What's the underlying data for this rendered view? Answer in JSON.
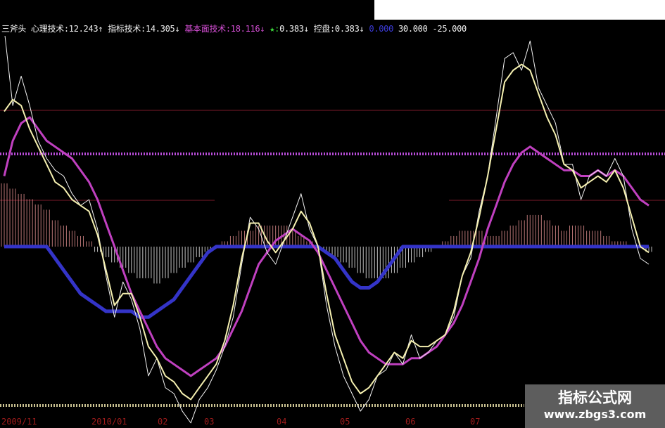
{
  "legend": {
    "name": "三斧头",
    "items": [
      {
        "label": "心理技术: ",
        "value": "12.243↑",
        "color": "#f2f2f2"
      },
      {
        "label": "指标技术: ",
        "value": "14.305↓",
        "color": "#f2f2f2"
      },
      {
        "label": "基本面技术: ",
        "value": "18.116↓",
        "color": "#d64fd6"
      },
      {
        "label": "★: ",
        "value": "0.383↓",
        "color": "#3ddc3d"
      },
      {
        "label": "控盘: ",
        "value": "0.383↓",
        "color": "#f2f2f2"
      }
    ],
    "tail": [
      {
        "text": "0.000",
        "color": "#3b3bd8"
      },
      {
        "text": "30.000",
        "color": "#f2f2f2"
      },
      {
        "text": "-25.000",
        "color": "#f2f2f2"
      }
    ]
  },
  "watermark": {
    "title": "指标公式网",
    "url": "www.zbgs3.com"
  },
  "colors": {
    "background": "#000000",
    "psych_line": "#f2f2f2",
    "indicator_line": "#f5f0b0",
    "fundamental_line": "#c040c0",
    "control_line": "#3434c8",
    "level_line_pink": "#b84cd8",
    "level_line_red": "#7a1a2a",
    "hist_up": "#d98a8a",
    "hist_down": "#e6e6e6",
    "axis_label": "#9e1b1b"
  },
  "chart_data": {
    "type": "line",
    "title": "三斧头",
    "x_labels": [
      "2009/11",
      "2010/01",
      "02",
      "03",
      "04",
      "05",
      "06",
      "07"
    ],
    "ylim": [
      -25,
      30
    ],
    "reference_levels": [
      {
        "name": "line-30",
        "value": 30,
        "style": "dotted-magenta"
      },
      {
        "name": "line-0",
        "value": 0,
        "style": "blue-control-base"
      }
    ],
    "series": [
      {
        "name": "心理技术",
        "values": [
          37,
          24,
          29,
          24,
          18,
          15,
          13,
          12,
          9,
          7,
          8,
          3,
          -5,
          -12,
          -6,
          -9,
          -14,
          -22,
          -19,
          -24,
          -25,
          -28,
          -30,
          -26,
          -24,
          -21,
          -17,
          -12,
          -3,
          5,
          3,
          -1,
          -3,
          1,
          5,
          9,
          3,
          0,
          -10,
          -17,
          -22,
          -25,
          -28,
          -26,
          -22,
          -21,
          -18,
          -20,
          -15,
          -19,
          -18,
          -16,
          -15,
          -12,
          -5,
          -2,
          6,
          12,
          22,
          32,
          33,
          30,
          35,
          27,
          24,
          21,
          14,
          14,
          8,
          12,
          13,
          12,
          15,
          12,
          3,
          -2,
          -3
        ]
      },
      {
        "name": "指标技术",
        "values": [
          23,
          25,
          24,
          20,
          17,
          14,
          11,
          10,
          8,
          7,
          6,
          2,
          -4,
          -10,
          -8,
          -8,
          -12,
          -17,
          -19,
          -22,
          -23,
          -25,
          -26,
          -24,
          -22,
          -20,
          -16,
          -10,
          -2,
          4,
          4,
          1,
          -1,
          1,
          3,
          6,
          4,
          0,
          -8,
          -15,
          -19,
          -23,
          -25,
          -24,
          -22,
          -20,
          -18,
          -19,
          -16,
          -17,
          -17,
          -16,
          -15,
          -11,
          -5,
          -1,
          5,
          12,
          20,
          28,
          30,
          31,
          30,
          26,
          22,
          19,
          14,
          13,
          10,
          11,
          12,
          11,
          13,
          10,
          5,
          0,
          -1
        ]
      },
      {
        "name": "基本面技术",
        "values": [
          12,
          18,
          21,
          22,
          20,
          18,
          17,
          16,
          15,
          13,
          11,
          8,
          4,
          0,
          -4,
          -8,
          -11,
          -14,
          -17,
          -19,
          -20,
          -21,
          -22,
          -21,
          -20,
          -19,
          -17,
          -14,
          -11,
          -7,
          -3,
          -1,
          1,
          2,
          3,
          2,
          1,
          -1,
          -4,
          -7,
          -10,
          -13,
          -16,
          -18,
          -19,
          -20,
          -20,
          -20,
          -19,
          -19,
          -18,
          -17,
          -15,
          -13,
          -10,
          -6,
          -2,
          3,
          7,
          11,
          14,
          16,
          17,
          16,
          15,
          14,
          13,
          13,
          12,
          12,
          13,
          12,
          13,
          12,
          10,
          8,
          7
        ]
      },
      {
        "name": "控盘",
        "values": [
          0,
          0,
          0,
          0,
          0,
          0,
          -2,
          -4,
          -6,
          -8,
          -9,
          -10,
          -11,
          -11,
          -11,
          -11,
          -12,
          -12,
          -11,
          -10,
          -9,
          -7,
          -5,
          -3,
          -1,
          0,
          0,
          0,
          0,
          0,
          0,
          0,
          0,
          0,
          0,
          0,
          0,
          0,
          -1,
          -2,
          -4,
          -6,
          -7,
          -7,
          -6,
          -4,
          -2,
          0,
          0,
          0,
          0,
          0,
          0,
          0,
          0,
          0,
          0,
          0,
          0,
          0,
          0,
          0,
          0,
          0,
          0,
          0,
          0,
          0,
          0,
          0,
          0,
          0,
          0,
          0,
          0,
          0,
          0
        ]
      },
      {
        "name": "柱状",
        "values": [
          12,
          11,
          10,
          9,
          8,
          7,
          5,
          4,
          3,
          2,
          1,
          -1,
          -2,
          -3,
          -4,
          -5,
          -6,
          -6,
          -7,
          -6,
          -5,
          -4,
          -3,
          -2,
          -1,
          0,
          1,
          2,
          3,
          3,
          4,
          4,
          4,
          4,
          3,
          2,
          1,
          0,
          -1,
          -2,
          -3,
          -4,
          -5,
          -6,
          -6,
          -6,
          -5,
          -4,
          -3,
          -2,
          -1,
          0,
          1,
          2,
          3,
          3,
          3,
          2,
          2,
          3,
          4,
          5,
          6,
          6,
          5,
          4,
          3,
          4,
          4,
          3,
          3,
          2,
          1,
          1,
          0,
          0,
          -1
        ]
      }
    ]
  }
}
